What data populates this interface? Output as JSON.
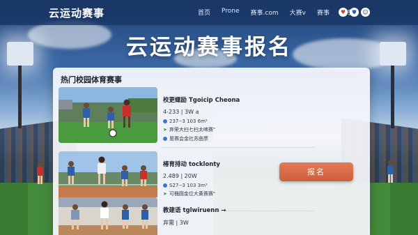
{
  "nav": {
    "brand": "云运动赛事",
    "links": [
      "首页",
      "Prone",
      "赛事.com",
      "大赛v",
      "赛事",
      "赛事"
    ],
    "icons": [
      {
        "name": "heart-icon",
        "glyph": "♥",
        "color": "#d23a3a"
      },
      {
        "name": "shield-icon",
        "glyph": "⛊",
        "color": "#2f5fa8"
      },
      {
        "name": "user-icon",
        "glyph": "☺",
        "color": "#2b3550"
      }
    ]
  },
  "hero": {
    "title": "云运动赛事报名"
  },
  "panel": {
    "title": "热门校园体育赛事",
    "events": [
      {
        "name": "校更蝶励  Tgoicip Cheona",
        "date": "4-233 | 3W a",
        "location": "237--3 103 6m²",
        "note": "弃荣大扫七扫太啤赛\"",
        "extra": "垦赛会金社苏曲票"
      },
      {
        "name": "椿育排动  tocklonty",
        "date": "2.489 | 20W",
        "location": "S27--3 103 3m²",
        "note": "可桶圆金位大黄赛赛\""
      },
      {
        "name": "教建语  tglwiruenn",
        "date": "弃需 | 3W",
        "arrow": "→"
      }
    ],
    "submit_label": "报名"
  },
  "colors": {
    "nav_bg": "#183462",
    "button": "#d9694a",
    "panel": "#f6f8fc"
  }
}
